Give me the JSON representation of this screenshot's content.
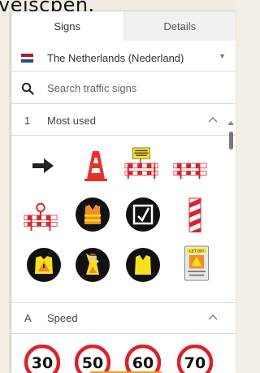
{
  "background_text": "veiscpen.",
  "tabs": [
    {
      "label": "Signs",
      "active": true
    },
    {
      "label": "Details",
      "active": false
    }
  ],
  "country": {
    "label": "The Netherlands (Nederland)",
    "flag_colors": [
      "#ae1c28",
      "#ffffff",
      "#21468b"
    ]
  },
  "search": {
    "placeholder": "Search traffic signs",
    "icon": "search-icon"
  },
  "sections": [
    {
      "key": "1",
      "title": "Most used",
      "expanded": true,
      "signs": [
        {
          "name": "arrow-right-sign-icon"
        },
        {
          "name": "traffic-cone-sign-icon"
        },
        {
          "name": "barrier-with-board-sign-icon",
          "board_text": "Voetgangers oversteek gebruiken"
        },
        {
          "name": "barrier-sign-icon"
        },
        {
          "name": "barrier-with-lamp-sign-icon"
        },
        {
          "name": "orange-vest-sign-icon"
        },
        {
          "name": "check-box-sign-icon"
        },
        {
          "name": "bollard-sign-icon"
        },
        {
          "name": "warning-vest-sign-icon"
        },
        {
          "name": "worker-sign-icon"
        },
        {
          "name": "yellow-vest-sign-icon"
        },
        {
          "name": "info-board-sign-icon",
          "board_text": "LET OP!"
        }
      ]
    },
    {
      "key": "A",
      "title": "Speed",
      "expanded": true,
      "signs": [
        {
          "name": "speed-limit-30-sign-icon",
          "value": "30"
        },
        {
          "name": "speed-limit-50-sign-icon",
          "value": "50"
        },
        {
          "name": "speed-limit-60-sign-icon",
          "value": "60"
        },
        {
          "name": "speed-limit-70-sign-icon",
          "value": "70"
        }
      ]
    }
  ],
  "colors": {
    "accent_orange": "#f29b1b",
    "sign_red": "#d9232d",
    "sign_yellow": "#f7e11b"
  }
}
